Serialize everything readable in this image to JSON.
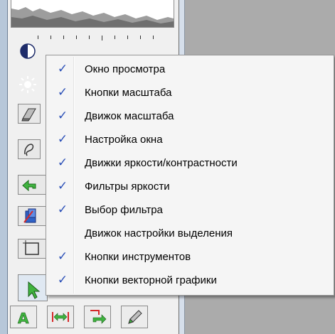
{
  "menu": {
    "items": [
      {
        "label": "Окно просмотра",
        "checked": true
      },
      {
        "label": "Кнопки масштаба",
        "checked": true
      },
      {
        "label": "Движок масштаба",
        "checked": true
      },
      {
        "label": "Настройка окна",
        "checked": true
      },
      {
        "label": "Движки яркости/контрастности",
        "checked": true
      },
      {
        "label": "Фильтры яркости",
        "checked": true
      },
      {
        "label": "Выбор фильтра",
        "checked": true
      },
      {
        "label": "Движок настройки выделения",
        "checked": false
      },
      {
        "label": "Кнопки инструментов",
        "checked": true
      },
      {
        "label": "Кнопки векторной графики",
        "checked": true
      }
    ],
    "check_glyph": "✓",
    "check_color": "#2a4fb7"
  },
  "icons": {
    "side_buttons": [
      "contrast-icon",
      "brightness-icon",
      "eraser-icon",
      "lasso-icon",
      "undo-arrow-icon",
      "layers-icon",
      "crop-icon",
      "select-arrow-icon"
    ],
    "bottom_buttons": [
      "vector-text-icon",
      "horizontal-resize-icon",
      "rotate-icon",
      "pen-icon"
    ]
  }
}
